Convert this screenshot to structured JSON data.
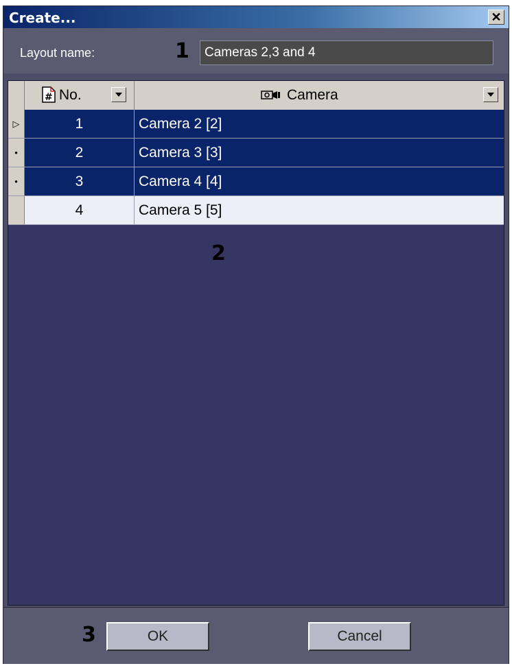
{
  "window": {
    "title": "Create...",
    "close_label": "✕"
  },
  "layout_name": {
    "label": "Layout name:",
    "value": "Cameras 2,3 and 4"
  },
  "markers": {
    "m1": "1",
    "m2": "2",
    "m3": "3"
  },
  "grid": {
    "columns": {
      "number": "No.",
      "camera": "Camera"
    },
    "rows": [
      {
        "indicator": "▷",
        "number": "1",
        "camera": "Camera 2 [2]",
        "selected": true
      },
      {
        "indicator": "•",
        "number": "2",
        "camera": "Camera 3 [3]",
        "selected": true
      },
      {
        "indicator": "•",
        "number": "3",
        "camera": "Camera 4 [4]",
        "selected": true
      },
      {
        "indicator": "",
        "number": "4",
        "camera": "Camera 5 [5]",
        "selected": false
      }
    ]
  },
  "buttons": {
    "ok": "OK",
    "cancel": "Cancel"
  },
  "colors": {
    "selection": "#0a246a",
    "grid_background": "#363663",
    "dialog_background": "#4e4e68"
  }
}
